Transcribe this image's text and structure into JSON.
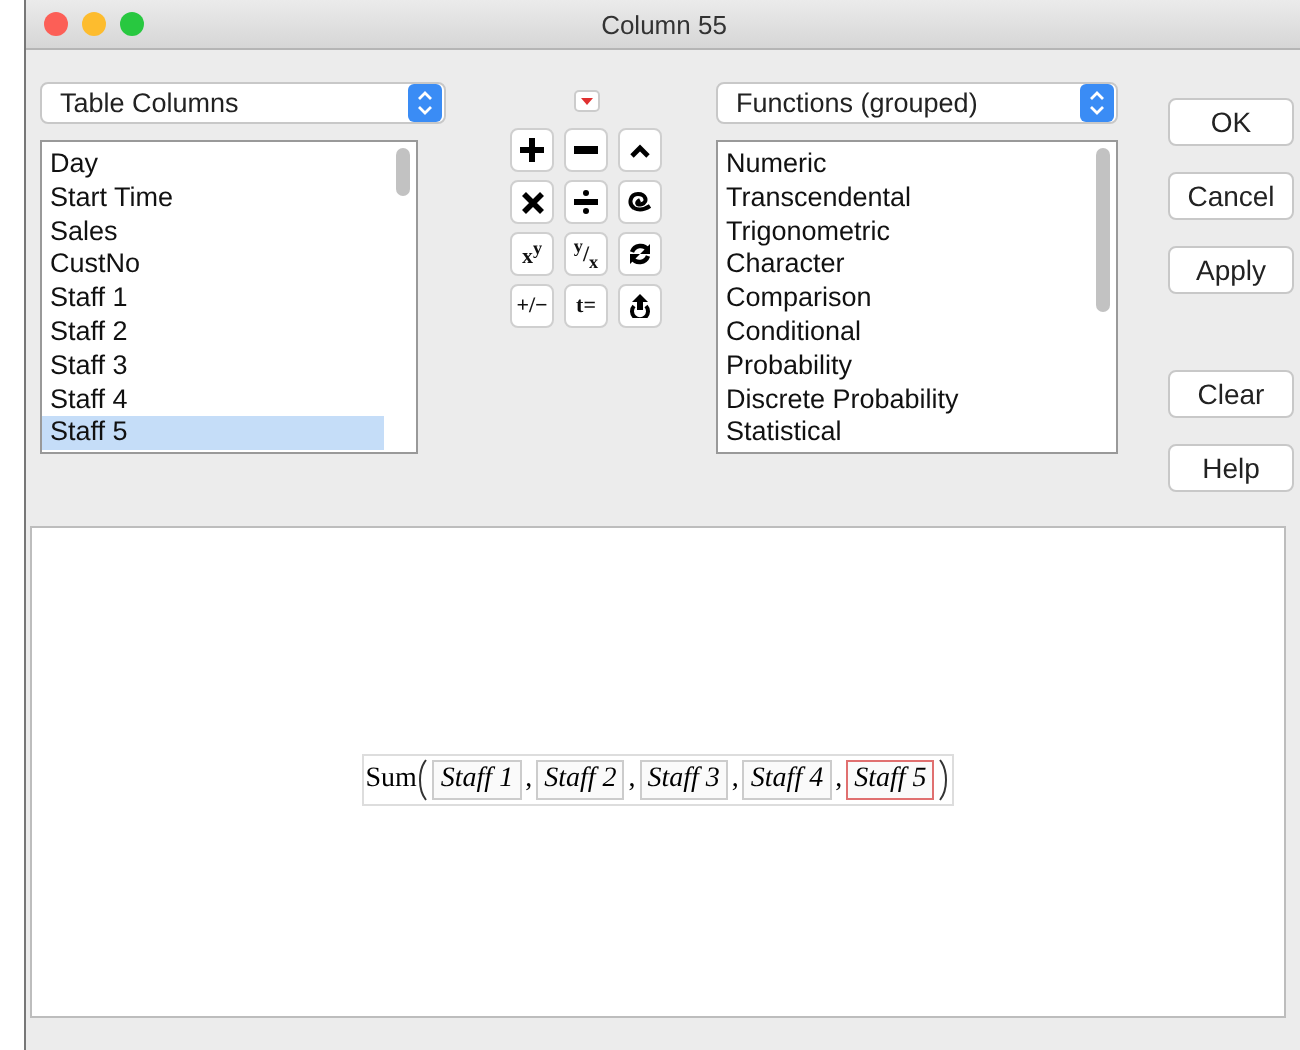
{
  "window": {
    "title": "Column 55"
  },
  "columns_popup": {
    "value": "Table Columns"
  },
  "columns": [
    {
      "label": "Day",
      "selected": false
    },
    {
      "label": "Start Time",
      "selected": false
    },
    {
      "label": "Sales",
      "selected": false
    },
    {
      "label": "CustNo",
      "selected": false
    },
    {
      "label": "Staff 1",
      "selected": false
    },
    {
      "label": "Staff 2",
      "selected": false
    },
    {
      "label": "Staff 3",
      "selected": false
    },
    {
      "label": "Staff 4",
      "selected": false
    },
    {
      "label": "Staff 5",
      "selected": true
    }
  ],
  "keypad": [
    {
      "kind": "plus"
    },
    {
      "kind": "minus"
    },
    {
      "kind": "caret"
    },
    {
      "kind": "times"
    },
    {
      "kind": "divide"
    },
    {
      "kind": "loop"
    },
    {
      "kind": "text",
      "label": "x$^{y}$"
    },
    {
      "kind": "text",
      "label": "$^{y}$/$_{x}$"
    },
    {
      "kind": "refresh"
    },
    {
      "kind": "text",
      "label": "+/−"
    },
    {
      "kind": "text",
      "label": "t="
    },
    {
      "kind": "upload"
    }
  ],
  "functions_popup": {
    "value": "Functions (grouped)"
  },
  "functions": [
    "Numeric",
    "Transcendental",
    "Trigonometric",
    "Character",
    "Comparison",
    "Conditional",
    "Probability",
    "Discrete Probability",
    "Statistical"
  ],
  "buttons": [
    "OK",
    "Cancel",
    "Apply",
    "Clear",
    "Help"
  ],
  "formula": {
    "function": "Sum",
    "separator": ",",
    "arguments": [
      {
        "label": "Staff 1",
        "selected": false
      },
      {
        "label": "Staff 2",
        "selected": false
      },
      {
        "label": "Staff 3",
        "selected": false
      },
      {
        "label": "Staff 4",
        "selected": false
      },
      {
        "label": "Staff 5",
        "selected": true
      }
    ]
  }
}
